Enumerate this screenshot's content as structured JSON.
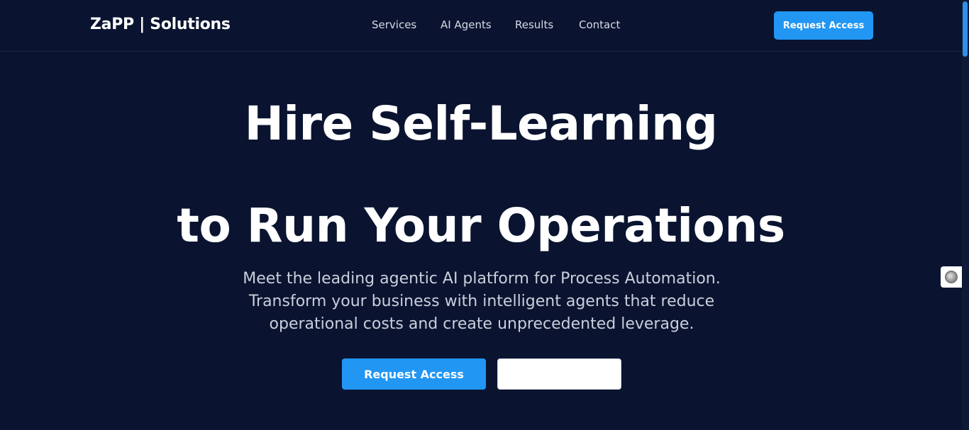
{
  "header": {
    "logo": "ZaPP | Solutions",
    "nav": [
      "Services",
      "AI Agents",
      "Results",
      "Contact"
    ],
    "cta_label": "Request Access"
  },
  "hero": {
    "title_line1": "Hire Self-Learning",
    "title_line2": "to Run Your Operations",
    "subtitle_lines": [
      "Meet the leading agentic AI platform for Process Automation.",
      "Transform your business with intelligent agents that reduce",
      "operational costs and create unprecedented leverage."
    ],
    "primary_cta": "Request Access",
    "secondary_cta": ""
  },
  "icons": {
    "floating_widget": "widget-circle-icon"
  },
  "colors": {
    "background": "#0a1430",
    "accent": "#2196f3",
    "text": "#ffffff",
    "muted_text": "#c9cfdb"
  }
}
